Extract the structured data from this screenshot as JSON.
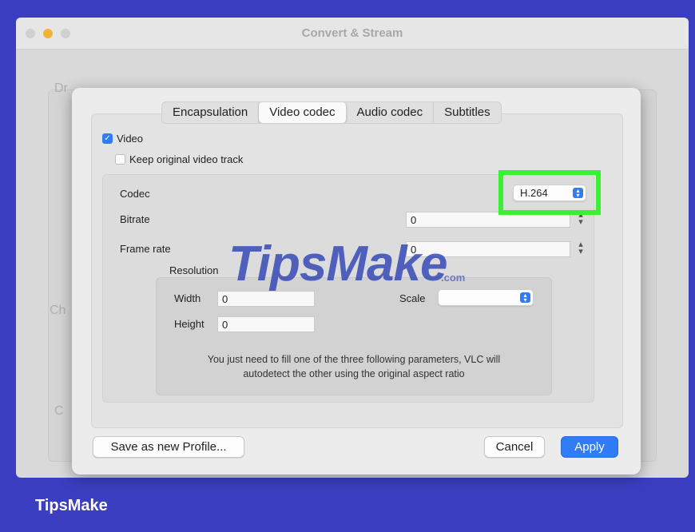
{
  "background_window": {
    "title": "Convert & Stream",
    "ghost_labels": [
      "Dr",
      "Ch",
      "C"
    ]
  },
  "dialog": {
    "tabs": [
      "Encapsulation",
      "Video codec",
      "Audio codec",
      "Subtitles"
    ],
    "active_tab": "Video codec",
    "video_checkbox": {
      "label": "Video",
      "checked": true
    },
    "keep_original_checkbox": {
      "label": "Keep original video track",
      "checked": false
    },
    "codec": {
      "label": "Codec",
      "value": "H.264"
    },
    "bitrate": {
      "label": "Bitrate",
      "value": "0"
    },
    "frame_rate": {
      "label": "Frame rate",
      "value": "0"
    },
    "resolution": {
      "label": "Resolution",
      "width_label": "Width",
      "width_value": "0",
      "height_label": "Height",
      "height_value": "0",
      "scale_label": "Scale",
      "scale_value": "",
      "hint_line1": "You just need to fill one of the three following parameters, VLC will",
      "hint_line2": "autodetect the other using the original aspect ratio"
    },
    "buttons": {
      "save_profile": "Save as new Profile...",
      "cancel": "Cancel",
      "apply": "Apply"
    }
  },
  "watermark": {
    "text": "TipsMake",
    "suffix": ".com"
  },
  "footer": {
    "brand": "TipsMake"
  },
  "colors": {
    "page_bg": "#3b3ec0",
    "accent": "#2f7cf6",
    "highlight": "#3bf033"
  }
}
